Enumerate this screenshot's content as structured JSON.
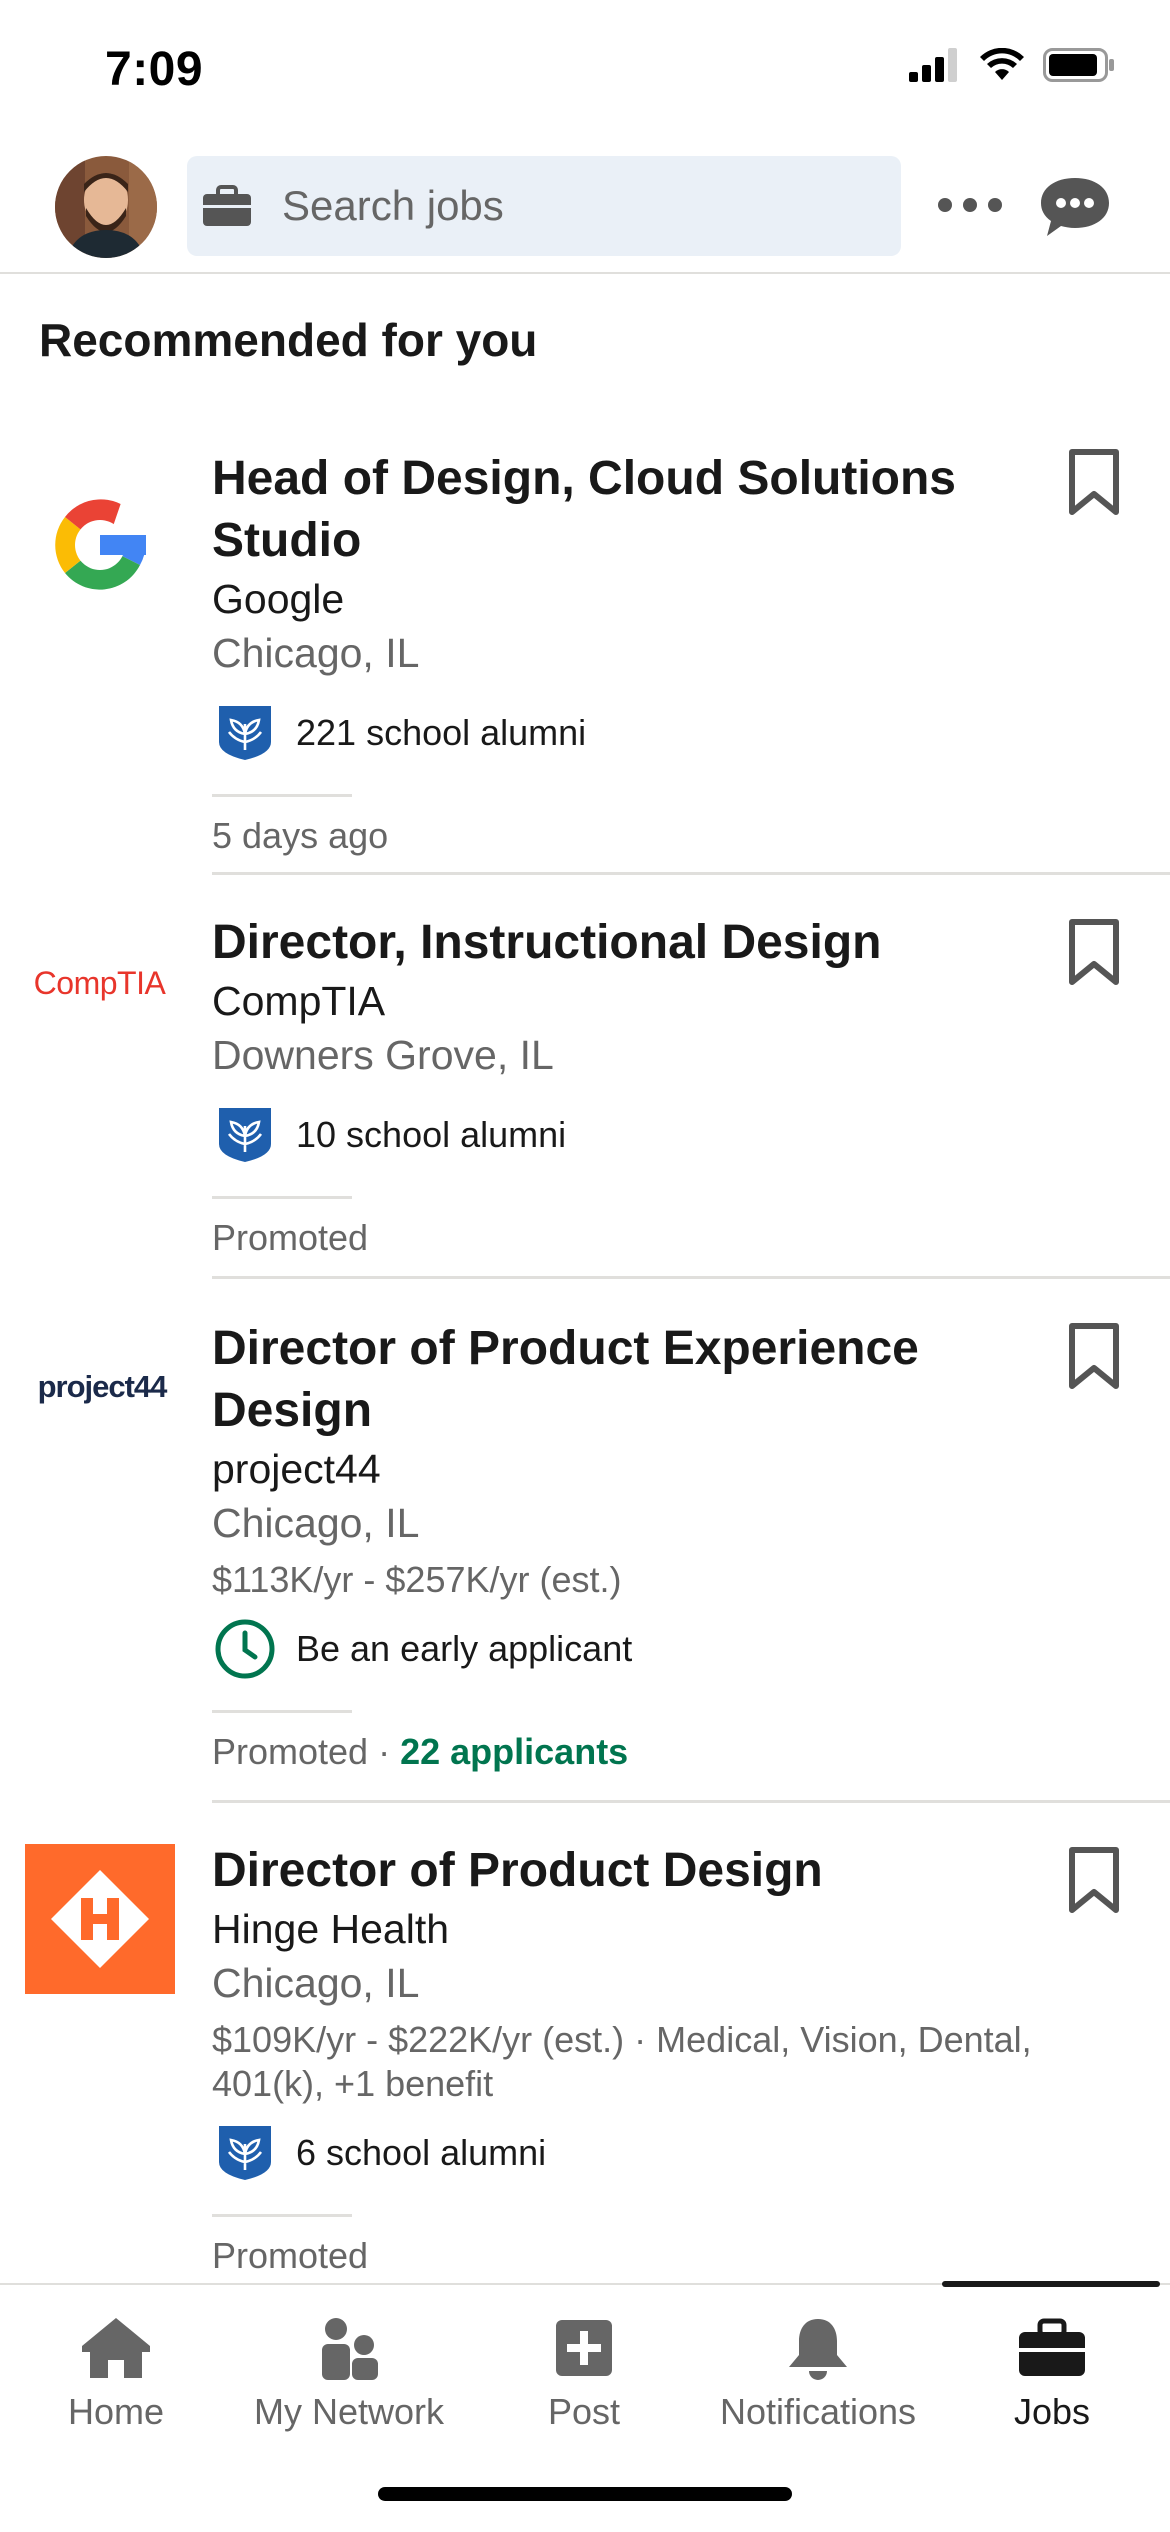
{
  "status_bar": {
    "time": "7:09"
  },
  "header": {
    "search_placeholder": "Search jobs",
    "avatar_icon": "profile-photo",
    "search_icon": "briefcase-icon",
    "more_icon": "more-horizontal-icon",
    "messaging_icon": "messaging-icon"
  },
  "section_title": "Recommended for you",
  "jobs": [
    {
      "title": "Head of Design, Cloud Solutions Studio",
      "company": "Google",
      "location": "Chicago, IL",
      "insight": "221 school alumni",
      "footer": "5 days ago"
    },
    {
      "title": "Director, Instructional Design",
      "company": "CompTIA",
      "logo_text": "CompTIA",
      "location": "Downers Grove, IL",
      "insight": "10 school alumni",
      "footer": "Promoted"
    },
    {
      "title": "Director of Product Experience Design",
      "company": "project44",
      "logo_text": "project44",
      "location": "Chicago, IL",
      "salary": "$113K/yr - $257K/yr (est.)",
      "insight": "Be an early applicant",
      "footer": "Promoted",
      "footer_separator": "·",
      "footer_highlight": "22 applicants"
    },
    {
      "title": "Director of Product Design",
      "company": "Hinge Health",
      "location": "Chicago, IL",
      "salary": "$109K/yr - $222K/yr (est.) · Medical, Vision, Dental, 401(k), +1 benefit",
      "insight": "6 school alumni",
      "footer": "Promoted"
    }
  ],
  "bottom_nav": [
    {
      "label": "Home",
      "icon": "home-icon"
    },
    {
      "label": "My Network",
      "icon": "network-icon"
    },
    {
      "label": "Post",
      "icon": "post-plus-icon"
    },
    {
      "label": "Notifications",
      "icon": "bell-icon"
    },
    {
      "label": "Jobs",
      "icon": "briefcase-icon",
      "active": true
    }
  ],
  "colors": {
    "accent_green": "#01754f",
    "search_bg": "#eaf0f7",
    "school_logo_blue": "#1f5fad",
    "hinge_orange": "#ff6a2b",
    "comptia_red": "#e8352b",
    "project44_navy": "#1b2a4a",
    "project44_blue": "#1f6fc1"
  }
}
